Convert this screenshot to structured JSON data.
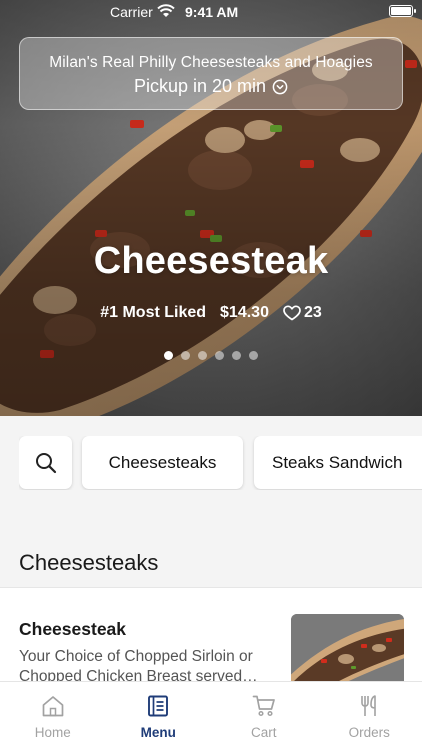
{
  "status_bar": {
    "carrier": "Carrier",
    "time": "9:41 AM"
  },
  "pickup": {
    "restaurant": "Milan's Real Philly Cheesesteaks and Hoagies",
    "time": "Pickup in 20 min"
  },
  "hero": {
    "title": "Cheesesteak",
    "rank": "#1 Most Liked",
    "price": "$14.30",
    "likes": "23",
    "carousel_count": 6,
    "carousel_active": 1
  },
  "categories": [
    "Cheesesteaks",
    "Steaks Sandwich"
  ],
  "section": {
    "title": "Cheesesteaks"
  },
  "item": {
    "name": "Cheesesteak",
    "description": "Your Choice of Chopped Sirloin or Chopped Chicken Breast served…"
  },
  "tabs": [
    {
      "label": "Home",
      "icon": "home-icon",
      "active": false
    },
    {
      "label": "Menu",
      "icon": "menu-icon",
      "active": true
    },
    {
      "label": "Cart",
      "icon": "cart-icon",
      "active": false
    },
    {
      "label": "Orders",
      "icon": "orders-icon",
      "active": false
    }
  ],
  "colors": {
    "accent": "#1f3c78",
    "inactive_tab": "#a2a2a2"
  }
}
